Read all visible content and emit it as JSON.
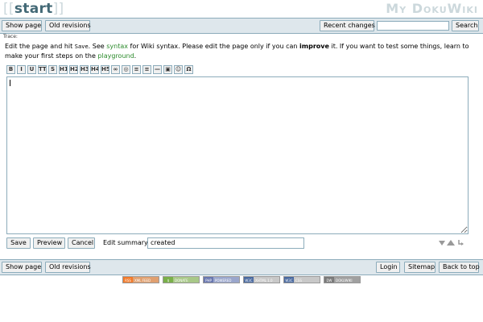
{
  "header": {
    "page_title": "start",
    "wiki_name": "My DokuWiki"
  },
  "top_bar": {
    "show_page": "Show page",
    "old_revisions": "Old revisions",
    "recent_changes": "Recent changes",
    "search_value": "",
    "search_button": "Search"
  },
  "trace_label": "Trace:",
  "intro": {
    "t1": "Edit the page and hit ",
    "save_word": "Save",
    "t2": ". See ",
    "syntax_link": "syntax",
    "t3": " for Wiki syntax. Please edit the page only if you can ",
    "improve_word": "improve",
    "t4": " it. If you want to test some things, learn to make your first steps on the ",
    "playground_link": "playground",
    "t5": "."
  },
  "toolbar": [
    {
      "icon": "bold-icon",
      "glyph": "B"
    },
    {
      "icon": "italic-icon",
      "glyph": "I"
    },
    {
      "icon": "underline-icon",
      "glyph": "U"
    },
    {
      "icon": "monospace-icon",
      "glyph": "TT"
    },
    {
      "icon": "strikethrough-icon",
      "glyph": "S"
    },
    {
      "icon": "heading1-icon",
      "glyph": "H1"
    },
    {
      "icon": "heading2-icon",
      "glyph": "H2"
    },
    {
      "icon": "heading3-icon",
      "glyph": "H3"
    },
    {
      "icon": "heading4-icon",
      "glyph": "H4"
    },
    {
      "icon": "heading5-icon",
      "glyph": "H5"
    },
    {
      "icon": "internal-link-icon",
      "glyph": "∞"
    },
    {
      "icon": "external-link-icon",
      "glyph": "◎"
    },
    {
      "icon": "ordered-list-icon",
      "glyph": "≡"
    },
    {
      "icon": "unordered-list-icon",
      "glyph": "≡"
    },
    {
      "icon": "horizontal-rule-icon",
      "glyph": "—"
    },
    {
      "icon": "image-icon",
      "glyph": "▣"
    },
    {
      "icon": "smiley-icon",
      "glyph": "☺"
    },
    {
      "icon": "special-chars-icon",
      "glyph": "Ω"
    }
  ],
  "editor": {
    "content": ""
  },
  "edit_buttons": {
    "save": "Save",
    "preview": "Preview",
    "cancel": "Cancel",
    "summary_label": "Edit summary",
    "summary_value": "created"
  },
  "bottom_bar": {
    "show_page": "Show page",
    "old_revisions": "Old revisions",
    "login": "Login",
    "sitemap": "Sitemap",
    "back_to_top": "Back to top"
  },
  "badges": [
    {
      "tag": "RSS",
      "label": "XML FEED",
      "color": "#f27a2a",
      "bg": "#e0a070"
    },
    {
      "tag": "$",
      "label": "DONATE",
      "color": "#7ab04a",
      "bg": "#a8c888"
    },
    {
      "tag": "PHP",
      "label": "POWERED",
      "color": "#6a78b0",
      "bg": "#9aa6cc"
    },
    {
      "tag": "W3C",
      "label": "XHTML 1.0",
      "color": "#4a6aa0",
      "bg": "#c8c8c8"
    },
    {
      "tag": "W3C",
      "label": "CSS",
      "color": "#4a6aa0",
      "bg": "#c8c8c8"
    },
    {
      "tag": "DW",
      "label": "DOKUWIKI",
      "color": "#7a7a7a",
      "bg": "#a0a0a0"
    }
  ],
  "colors": {
    "bar_bg": "#dee7ec",
    "border": "#8cacbb",
    "title": "#436976",
    "link": "#2a8a2a"
  }
}
